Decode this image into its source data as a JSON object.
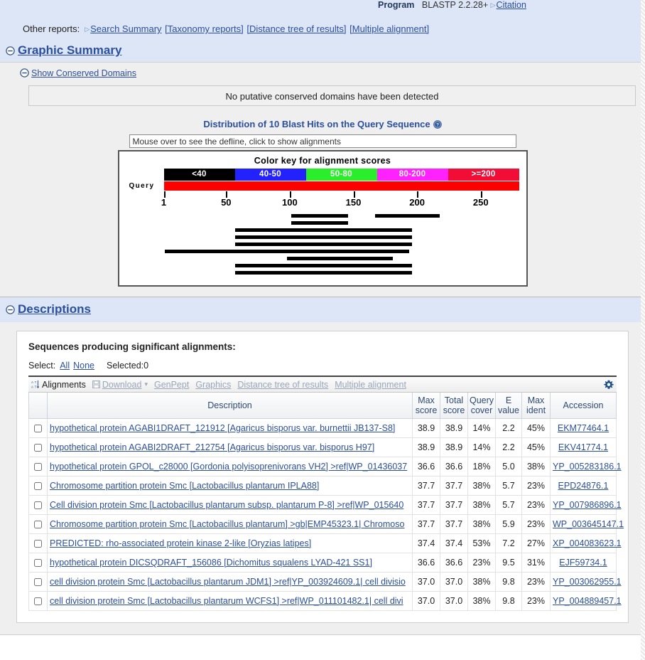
{
  "header": {
    "program_label": "Program",
    "program_value": "BLASTP 2.2.28+",
    "citation_link": "Citation"
  },
  "other_reports": {
    "label": "Other reports:",
    "links": [
      "Search Summary",
      "[Taxonomy reports]",
      "[Distance tree of results]",
      "[Multiple alignment]"
    ]
  },
  "graphic_summary": {
    "section_title": "Graphic Summary",
    "show_conserved_domains": "Show Conserved Domains",
    "no_domains_message": "No putative conserved domains have been detected",
    "distribution_title": "Distribution of 10 Blast Hits on the Query Sequence",
    "help_icon": "help-circle-icon",
    "mouseover_hint": "Mouse over to see the defline, click to show alignments",
    "color_key_title": "Color key for alignment scores",
    "query_label": "Query"
  },
  "descriptions": {
    "section_title": "Descriptions",
    "significant_title": "Sequences producing significant alignments:",
    "select_label": "Select:",
    "select_all": "All",
    "select_none": "None",
    "selected_count": "Selected:0",
    "toolbar": {
      "alignments": "Alignments",
      "download": "Download",
      "genpept": "GenPept",
      "graphics": "Graphics",
      "distance_tree": "Distance tree of results",
      "multiple_alignment": "Multiple alignment",
      "sort_icon": "sort-az-icon",
      "disk_icon": "floppy-disk-icon",
      "chevron_icon": "chevron-down-icon",
      "gear_icon": "gear-icon"
    },
    "columns": [
      "Description",
      "Max score",
      "Total score",
      "Query cover",
      "E value",
      "Max ident",
      "Accession"
    ],
    "rows": [
      {
        "description": "hypothetical protein AGABI1DRAFT_121912 [Agaricus bisporus var. burnettii JB137-S8]",
        "max_score": "38.9",
        "total_score": "38.9",
        "query_cover": "14%",
        "e_value": "2.2",
        "max_ident": "45%",
        "accession": "EKM77464.1"
      },
      {
        "description": "hypothetical protein AGABI2DRAFT_212754 [Agaricus bisporus var. bisporus H97]",
        "max_score": "38.9",
        "total_score": "38.9",
        "query_cover": "14%",
        "e_value": "2.2",
        "max_ident": "45%",
        "accession": "EKV41774.1"
      },
      {
        "description": "hypothetical protein GPOL_c28000 [Gordonia polyisoprenivorans VH2] >ref|WP_01436037",
        "max_score": "36.6",
        "total_score": "36.6",
        "query_cover": "18%",
        "e_value": "5.0",
        "max_ident": "38%",
        "accession": "YP_005283186.1"
      },
      {
        "description": "Chromosome partition protein Smc [Lactobacillus plantarum IPLA88]",
        "max_score": "37.7",
        "total_score": "37.7",
        "query_cover": "38%",
        "e_value": "5.7",
        "max_ident": "23%",
        "accession": "EPD24876.1"
      },
      {
        "description": "Cell division protein Smc [Lactobacillus plantarum subsp. plantarum P-8] >ref|WP_015640",
        "max_score": "37.7",
        "total_score": "37.7",
        "query_cover": "38%",
        "e_value": "5.7",
        "max_ident": "23%",
        "accession": "YP_007986896.1"
      },
      {
        "description": "Chromosome partition protein Smc [Lactobacillus plantarum] >gb|EMP45323.1| Chromoso",
        "max_score": "37.7",
        "total_score": "37.7",
        "query_cover": "38%",
        "e_value": "5.9",
        "max_ident": "23%",
        "accession": "WP_003645147.1"
      },
      {
        "description": "PREDICTED: rho-associated protein kinase 2-like [Oryzias latipes]",
        "max_score": "37.4",
        "total_score": "37.4",
        "query_cover": "53%",
        "e_value": "7.2",
        "max_ident": "27%",
        "accession": "XP_004083623.1"
      },
      {
        "description": "hypothetical protein DICSQDRAFT_156086 [Dichomitus squalens LYAD-421 SS1]",
        "max_score": "36.6",
        "total_score": "36.6",
        "query_cover": "23%",
        "e_value": "9.5",
        "max_ident": "31%",
        "accession": "EJF59734.1"
      },
      {
        "description": "cell division protein Smc [Lactobacillus plantarum JDM1] >ref|YP_003924609.1| cell divisio",
        "max_score": "37.0",
        "total_score": "37.0",
        "query_cover": "38%",
        "e_value": "9.8",
        "max_ident": "23%",
        "accession": "YP_003062955.1"
      },
      {
        "description": "cell division protein Smc [Lactobacillus plantarum WCFS1] >ref|WP_011101482.1| cell divi",
        "max_score": "37.0",
        "total_score": "37.0",
        "query_cover": "38%",
        "e_value": "9.8",
        "max_ident": "23%",
        "accession": "YP_004889457.1"
      }
    ]
  },
  "chart_data": {
    "type": "bar",
    "title": "Distribution of 10 Blast Hits on the Query Sequence",
    "xlabel": "",
    "ylabel": "",
    "xlim": [
      1,
      280
    ],
    "tick_values": [
      1,
      50,
      100,
      150,
      200,
      250
    ],
    "tick_labels": [
      "1",
      "50",
      "100",
      "150",
      "200",
      "250"
    ],
    "query_bar_color": "#ff0000",
    "grid": false,
    "legend_position": "top",
    "color_key": [
      {
        "label": "<40",
        "color": "#000000"
      },
      {
        "label": "40-50",
        "color": "#2222ff"
      },
      {
        "label": "50-80",
        "color": "#2aee2a"
      },
      {
        "label": "80-200",
        "color": "#ff22ff"
      },
      {
        "label": ">=200",
        "color": "#f20d36"
      }
    ],
    "hits": [
      {
        "row": 0,
        "segments": [
          [
            101,
            146
          ],
          [
            167,
            218
          ]
        ],
        "color": "#000000"
      },
      {
        "row": 1,
        "segments": [
          [
            101,
            146
          ]
        ],
        "color": "#000000"
      },
      {
        "row": 2,
        "segments": [
          [
            57,
            196
          ]
        ],
        "color": "#000000"
      },
      {
        "row": 3,
        "segments": [
          [
            57,
            196
          ]
        ],
        "color": "#000000"
      },
      {
        "row": 4,
        "segments": [
          [
            57,
            196
          ]
        ],
        "color": "#000000"
      },
      {
        "row": 5,
        "segments": [
          [
            2,
            194
          ]
        ],
        "color": "#000000"
      },
      {
        "row": 6,
        "segments": [
          [
            98,
            181
          ]
        ],
        "color": "#000000"
      },
      {
        "row": 7,
        "segments": [
          [
            57,
            196
          ]
        ],
        "color": "#000000"
      },
      {
        "row": 8,
        "segments": [
          [
            57,
            196
          ]
        ],
        "color": "#000000"
      }
    ]
  }
}
